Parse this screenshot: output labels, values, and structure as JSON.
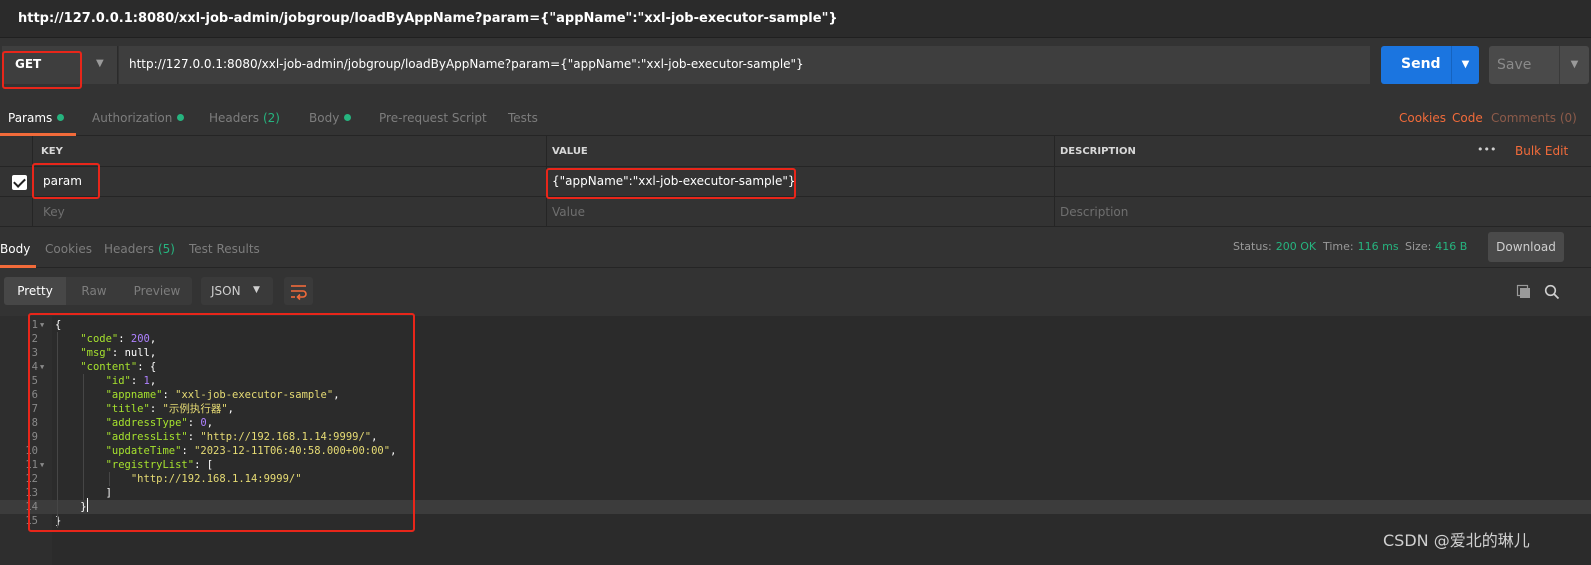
{
  "window": {
    "title": "http://127.0.0.1:8080/xxl-job-admin/jobgroup/loadByAppName?param={\"appName\":\"xxl-job-executor-sample\"}"
  },
  "request": {
    "method": "GET",
    "url": "http://127.0.0.1:8080/xxl-job-admin/jobgroup/loadByAppName?param={\"appName\":\"xxl-job-executor-sample\"}",
    "send_label": "Send",
    "save_label": "Save"
  },
  "request_tabs": {
    "params": "Params",
    "authorization": "Authorization",
    "headers": "Headers",
    "headers_count": "(2)",
    "body": "Body",
    "prerequest": "Pre-request Script",
    "tests": "Tests",
    "cookies": "Cookies",
    "code": "Code",
    "comments": "Comments (0)"
  },
  "params_table": {
    "headers": {
      "key": "KEY",
      "value": "VALUE",
      "description": "DESCRIPTION"
    },
    "more": "•••",
    "bulk_edit": "Bulk Edit",
    "row": {
      "key": "param",
      "value": "{\"appName\":\"xxl-job-executor-sample\"}",
      "description": ""
    },
    "placeholders": {
      "key": "Key",
      "value": "Value",
      "description": "Description"
    }
  },
  "response_tabs": {
    "body": "Body",
    "cookies": "Cookies",
    "headers": "Headers",
    "headers_count": "(5)",
    "test_results": "Test Results"
  },
  "response_status": {
    "status_label": "Status:",
    "status_value": "200 OK",
    "time_label": "Time:",
    "time_value": "116 ms",
    "size_label": "Size:",
    "size_value": "416 B",
    "download": "Download"
  },
  "view": {
    "pretty": "Pretty",
    "raw": "Raw",
    "preview": "Preview",
    "format": "JSON"
  },
  "response_body": {
    "lines": [
      {
        "n": "1",
        "fold": true,
        "text": "{"
      },
      {
        "n": "2",
        "text": "    \"code\": 200,"
      },
      {
        "n": "3",
        "text": "    \"msg\": null,"
      },
      {
        "n": "4",
        "fold": true,
        "text": "    \"content\": {"
      },
      {
        "n": "5",
        "text": "        \"id\": 1,"
      },
      {
        "n": "6",
        "text": "        \"appname\": \"xxl-job-executor-sample\","
      },
      {
        "n": "7",
        "text": "        \"title\": \"示例执行器\","
      },
      {
        "n": "8",
        "text": "        \"addressType\": 0,"
      },
      {
        "n": "9",
        "text": "        \"addressList\": \"http://192.168.1.14:9999/\","
      },
      {
        "n": "10",
        "text": "        \"updateTime\": \"2023-12-11T06:40:58.000+00:00\","
      },
      {
        "n": "11",
        "fold": true,
        "text": "        \"registryList\": ["
      },
      {
        "n": "12",
        "text": "            \"http://192.168.1.14:9999/\""
      },
      {
        "n": "13",
        "text": "        ]"
      },
      {
        "n": "14",
        "text": "    }"
      },
      {
        "n": "15",
        "text": "}"
      }
    ]
  },
  "watermark": "CSDN @爱北的琳儿",
  "colors": {
    "accent": "#f26b3a",
    "send": "#1b75e0",
    "ok": "#26b47f",
    "highlight": "#e8261a"
  }
}
